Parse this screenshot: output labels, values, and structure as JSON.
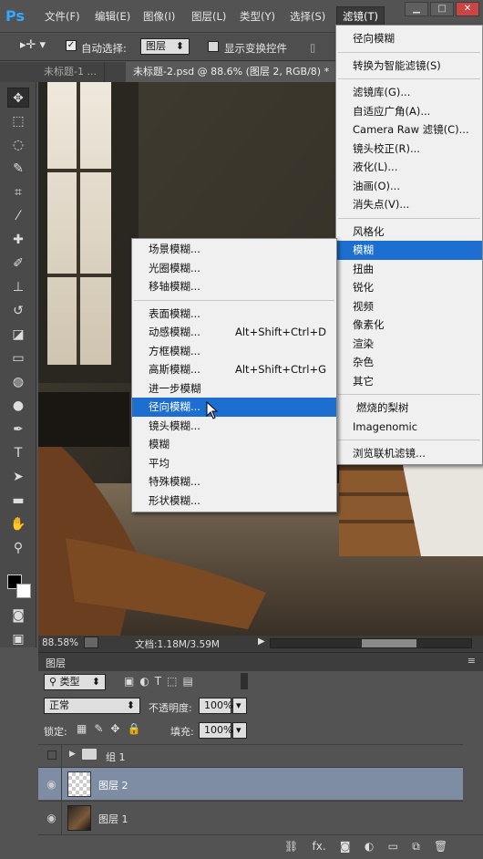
{
  "menubar": {
    "logo": "Ps",
    "items": [
      "文件(F)",
      "编辑(E)",
      "图像(I)",
      "图层(L)",
      "类型(Y)",
      "选择(S)",
      "滤镜(T)"
    ]
  },
  "options": {
    "auto_select_label": "自动选择:",
    "auto_select_value": "图层",
    "show_transform_label": "显示变换控件"
  },
  "tabs": [
    {
      "label": "未标题-1 ..."
    },
    {
      "label": "未标题-2.psd @ 88.6% (图层 2, RGB/8) *"
    }
  ],
  "status": {
    "zoom": "88.58%",
    "doc": "文档:1.18M/3.59M"
  },
  "filter_menu": {
    "last": "径向模糊",
    "smart": "转换为智能滤镜(S)",
    "group1": [
      "滤镜库(G)...",
      "自适应广角(A)...",
      "Camera Raw 滤镜(C)...",
      "镜头校正(R)...",
      "液化(L)...",
      "油画(O)...",
      "消失点(V)..."
    ],
    "group2": [
      "风格化",
      "模糊",
      "扭曲",
      "锐化",
      "视频",
      "像素化",
      "渲染",
      "杂色",
      "其它"
    ],
    "group3": [
      "燃烧的梨树",
      "Imagenomic"
    ],
    "browse": "浏览联机滤镜..."
  },
  "blur_menu": {
    "group1": [
      "场景模糊...",
      "光圈模糊...",
      "移轴模糊..."
    ],
    "group2": [
      {
        "label": "表面模糊...",
        "shortcut": ""
      },
      {
        "label": "动感模糊...",
        "shortcut": "Alt+Shift+Ctrl+D"
      },
      {
        "label": "方框模糊...",
        "shortcut": ""
      },
      {
        "label": "高斯模糊...",
        "shortcut": "Alt+Shift+Ctrl+G"
      },
      {
        "label": "进一步模糊",
        "shortcut": ""
      },
      {
        "label": "径向模糊...",
        "shortcut": ""
      },
      {
        "label": "镜头模糊...",
        "shortcut": ""
      },
      {
        "label": "模糊",
        "shortcut": ""
      },
      {
        "label": "平均",
        "shortcut": ""
      },
      {
        "label": "特殊模糊...",
        "shortcut": ""
      },
      {
        "label": "形状模糊...",
        "shortcut": ""
      }
    ]
  },
  "layers_panel": {
    "title": "图层",
    "kind": "类型",
    "blend": "正常",
    "opacity_label": "不透明度:",
    "opacity": "100%",
    "lock_label": "锁定:",
    "fill_label": "填充:",
    "fill": "100%",
    "layers": [
      {
        "name": "组 1",
        "type": "group"
      },
      {
        "name": "图层 2",
        "type": "layer",
        "selected": true
      },
      {
        "name": "图层 1",
        "type": "layer"
      }
    ]
  },
  "colors": {
    "highlight": "#1c6fd1",
    "ps_blue": "#31a8ff"
  }
}
